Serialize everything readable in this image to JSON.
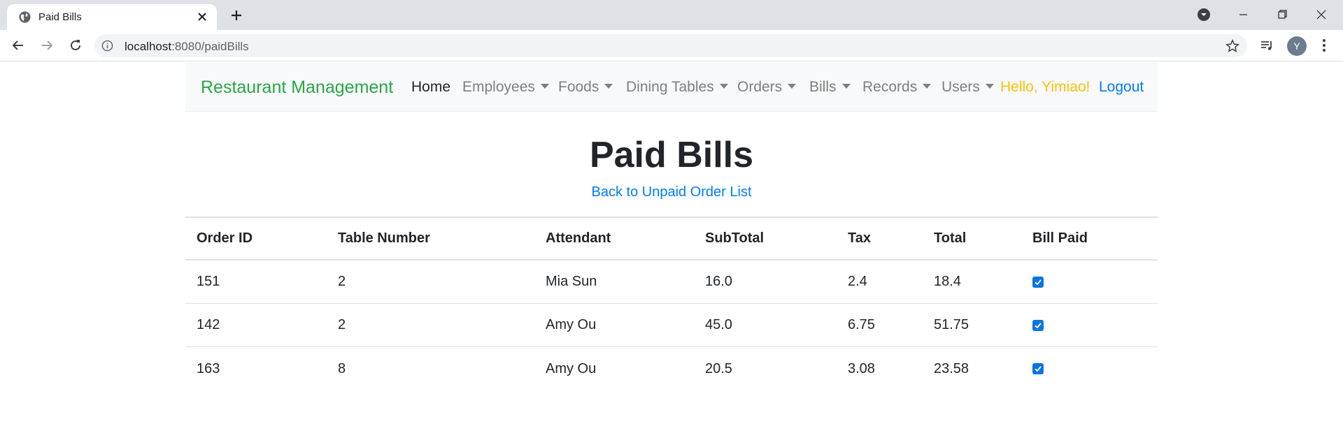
{
  "browser": {
    "tab_title": "Paid Bills",
    "url_host": "localhost",
    "url_path": ":8080/paidBills",
    "profile_initial": "Y"
  },
  "navbar": {
    "brand": "Restaurant Management",
    "home": "Home",
    "dropdowns": [
      "Employees",
      "Foods",
      "Dining Tables",
      "Orders",
      "Bills",
      "Records",
      "Users"
    ],
    "greeting": "Hello, Yimiao!",
    "logout": "Logout"
  },
  "main": {
    "title": "Paid Bills",
    "back_link": "Back to Unpaid Order List"
  },
  "table": {
    "headers": [
      "Order ID",
      "Table Number",
      "Attendant",
      "SubTotal",
      "Tax",
      "Total",
      "Bill Paid"
    ],
    "rows": [
      [
        "151",
        "2",
        "Mia Sun",
        "16.0",
        "2.4",
        "18.4",
        "checked"
      ],
      [
        "142",
        "2",
        "Amy Ou",
        "45.0",
        "6.75",
        "51.75",
        "checked"
      ],
      [
        "163",
        "8",
        "Amy Ou",
        "20.5",
        "3.08",
        "23.58",
        "checked"
      ]
    ]
  },
  "colors": {
    "brand": "#28a745",
    "greeting": "#ffc107",
    "link": "#007bff",
    "checkbox": "#0b74e5"
  }
}
